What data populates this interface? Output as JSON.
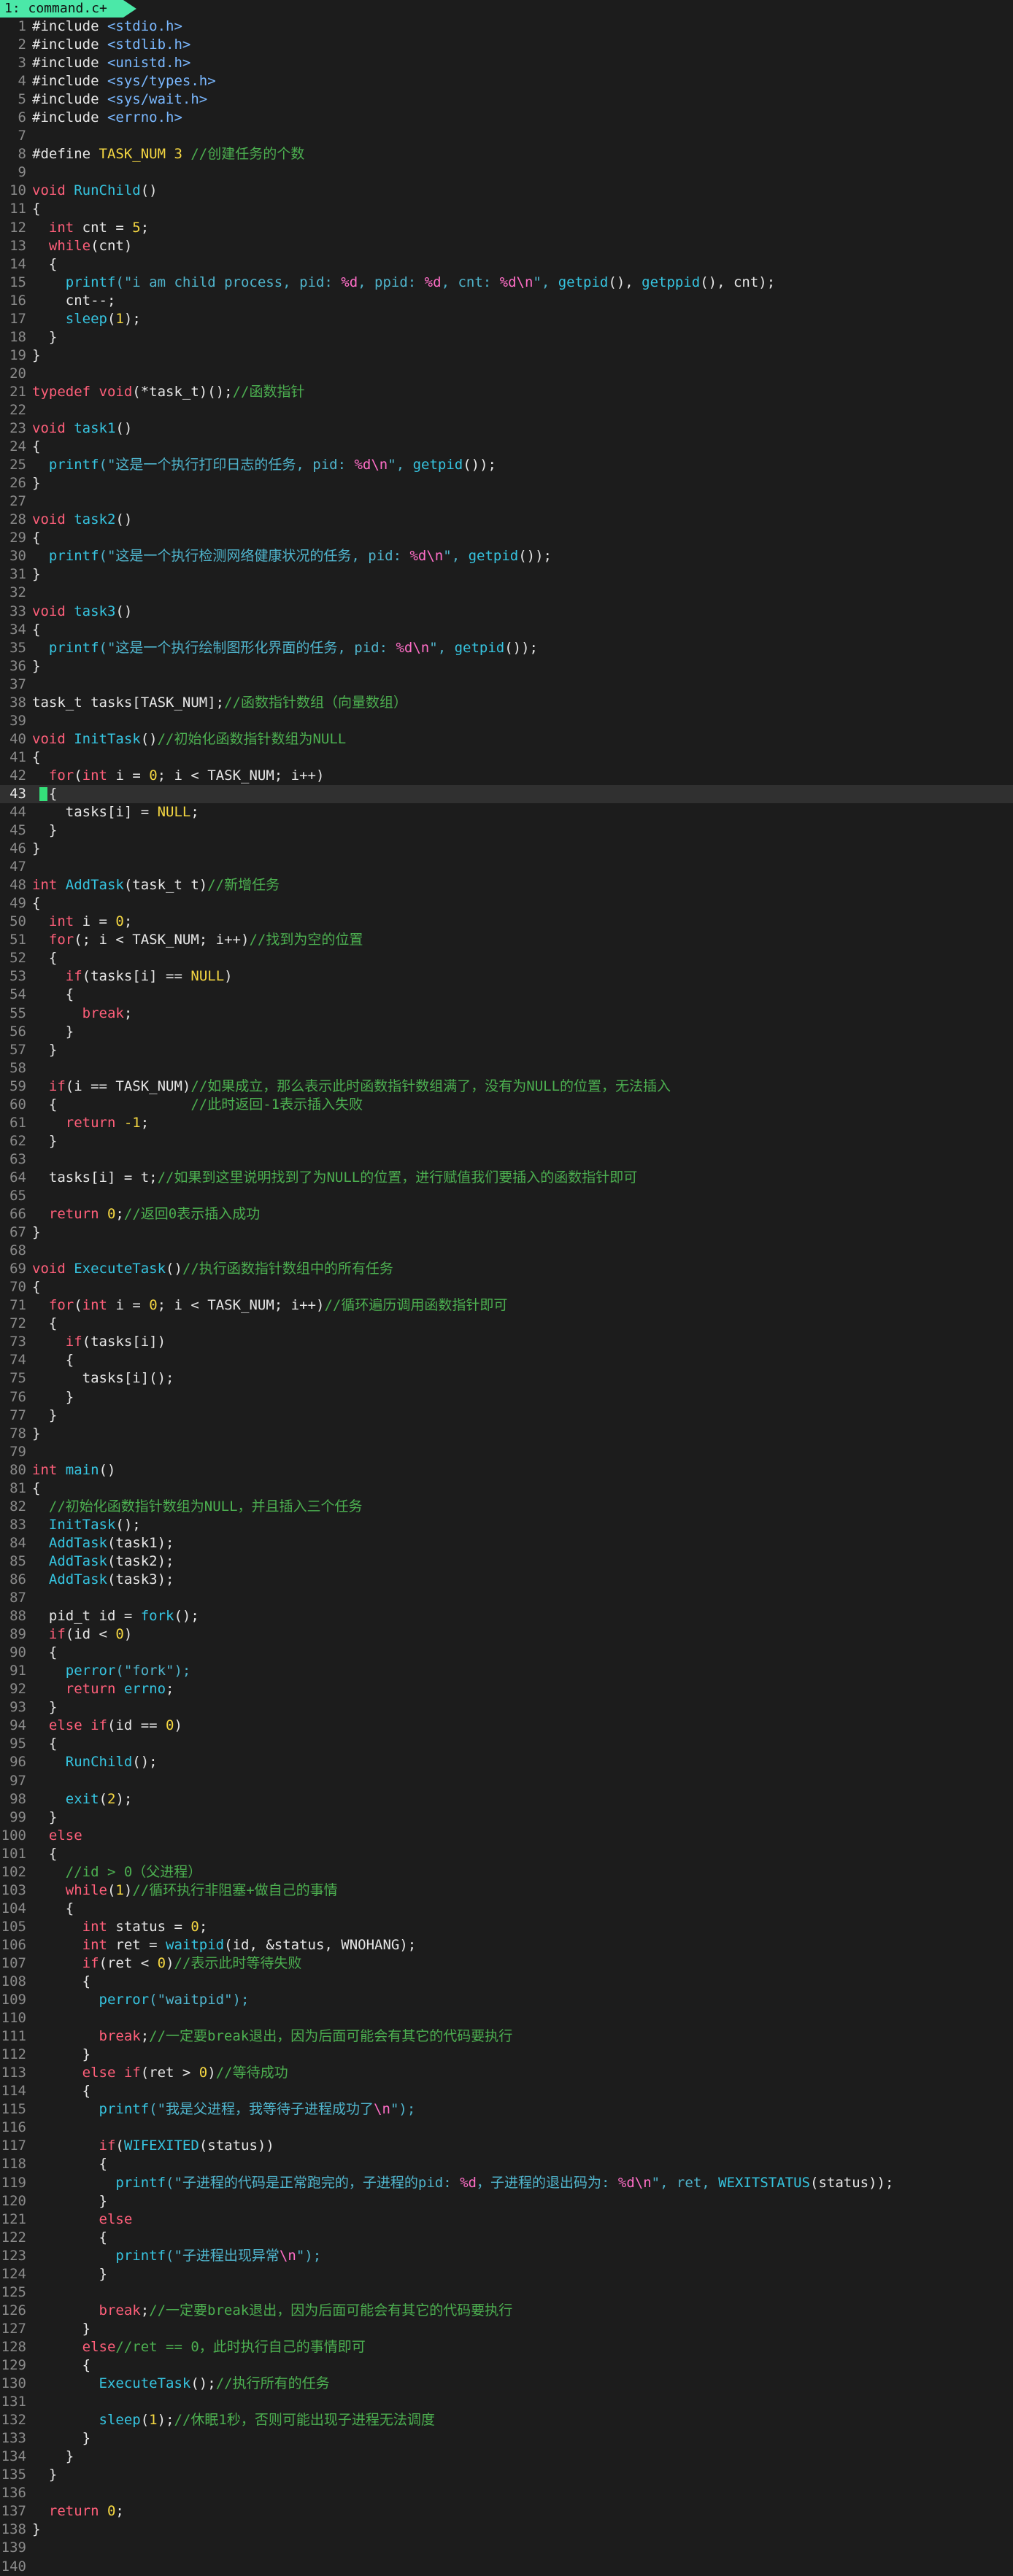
{
  "tab": {
    "label": "1: command.c+"
  },
  "cursor_line": 43,
  "colors": {
    "background": "#1c1c1c",
    "tab": "#4be8a8",
    "keyword": "#ff5f7a",
    "function": "#36c4e0",
    "string": "#4fb4cc",
    "number": "#f5d742",
    "comment": "#4caf50",
    "format": "#ff6ec7",
    "cursor": "#35e07a"
  },
  "lines": [
    [
      [
        "#include ",
        "tx"
      ],
      [
        "<stdio.h>",
        "hdr"
      ]
    ],
    [
      [
        "#include ",
        "tx"
      ],
      [
        "<stdlib.h>",
        "hdr"
      ]
    ],
    [
      [
        "#include ",
        "tx"
      ],
      [
        "<unistd.h>",
        "hdr"
      ]
    ],
    [
      [
        "#include ",
        "tx"
      ],
      [
        "<sys/types.h>",
        "hdr"
      ]
    ],
    [
      [
        "#include ",
        "tx"
      ],
      [
        "<sys/wait.h>",
        "hdr"
      ]
    ],
    [
      [
        "#include ",
        "tx"
      ],
      [
        "<errno.h>",
        "hdr"
      ]
    ],
    [],
    [
      [
        "#define ",
        "tx"
      ],
      [
        "TASK_NUM ",
        "num"
      ],
      [
        "3 ",
        "num"
      ],
      [
        "//创建任务的个数",
        "cm"
      ]
    ],
    [],
    [
      [
        "void ",
        "kw"
      ],
      [
        "RunChild",
        "fn"
      ],
      [
        "()",
        "tx"
      ]
    ],
    [
      [
        "{",
        "tx"
      ]
    ],
    [
      [
        "  ",
        "tx"
      ],
      [
        "int ",
        "kw"
      ],
      [
        "cnt = ",
        "tx"
      ],
      [
        "5",
        "num"
      ],
      [
        ";",
        "tx"
      ]
    ],
    [
      [
        "  ",
        "tx"
      ],
      [
        "while",
        "kw"
      ],
      [
        "(cnt)",
        "tx"
      ]
    ],
    [
      [
        "  {",
        "tx"
      ]
    ],
    [
      [
        "    ",
        "tx"
      ],
      [
        "printf",
        "fn"
      ],
      [
        "(\"i am child process, pid: ",
        "str"
      ],
      [
        "%d",
        "esc"
      ],
      [
        ", ppid: ",
        "str"
      ],
      [
        "%d",
        "esc"
      ],
      [
        ", cnt: ",
        "str"
      ],
      [
        "%d\\n",
        "esc"
      ],
      [
        "\", ",
        "str"
      ],
      [
        "getpid",
        "fn"
      ],
      [
        "(), ",
        "tx"
      ],
      [
        "getppid",
        "fn"
      ],
      [
        "(), cnt);",
        "tx"
      ]
    ],
    [
      [
        "    cnt--;",
        "tx"
      ]
    ],
    [
      [
        "    ",
        "tx"
      ],
      [
        "sleep",
        "fn"
      ],
      [
        "(",
        "tx"
      ],
      [
        "1",
        "num"
      ],
      [
        ");",
        "tx"
      ]
    ],
    [
      [
        "  }",
        "tx"
      ]
    ],
    [
      [
        "}",
        "tx"
      ]
    ],
    [],
    [
      [
        "typedef ",
        "kw"
      ],
      [
        "void",
        "kw"
      ],
      [
        "(*task_t)();",
        "tx"
      ],
      [
        "//函数指针",
        "cm"
      ]
    ],
    [],
    [
      [
        "void ",
        "kw"
      ],
      [
        "task1",
        "fn"
      ],
      [
        "()",
        "tx"
      ]
    ],
    [
      [
        "{",
        "tx"
      ]
    ],
    [
      [
        "  ",
        "tx"
      ],
      [
        "printf",
        "fn"
      ],
      [
        "(\"这是一个执行打印日志的任务, pid: ",
        "str"
      ],
      [
        "%d\\n",
        "esc"
      ],
      [
        "\", ",
        "str"
      ],
      [
        "getpid",
        "fn"
      ],
      [
        "());",
        "tx"
      ]
    ],
    [
      [
        "}",
        "tx"
      ]
    ],
    [],
    [
      [
        "void ",
        "kw"
      ],
      [
        "task2",
        "fn"
      ],
      [
        "()",
        "tx"
      ]
    ],
    [
      [
        "{",
        "tx"
      ]
    ],
    [
      [
        "  ",
        "tx"
      ],
      [
        "printf",
        "fn"
      ],
      [
        "(\"这是一个执行检测网络健康状况的任务, pid: ",
        "str"
      ],
      [
        "%d\\n",
        "esc"
      ],
      [
        "\", ",
        "str"
      ],
      [
        "getpid",
        "fn"
      ],
      [
        "());",
        "tx"
      ]
    ],
    [
      [
        "}",
        "tx"
      ]
    ],
    [],
    [
      [
        "void ",
        "kw"
      ],
      [
        "task3",
        "fn"
      ],
      [
        "()",
        "tx"
      ]
    ],
    [
      [
        "{",
        "tx"
      ]
    ],
    [
      [
        "  ",
        "tx"
      ],
      [
        "printf",
        "fn"
      ],
      [
        "(\"这是一个执行绘制图形化界面的任务, pid: ",
        "str"
      ],
      [
        "%d\\n",
        "esc"
      ],
      [
        "\", ",
        "str"
      ],
      [
        "getpid",
        "fn"
      ],
      [
        "());",
        "tx"
      ]
    ],
    [
      [
        "}",
        "tx"
      ]
    ],
    [],
    [
      [
        "task_t tasks[TASK_NUM];",
        "tx"
      ],
      [
        "//函数指针数组（向量数组）",
        "cm"
      ]
    ],
    [],
    [
      [
        "void ",
        "kw"
      ],
      [
        "InitTask",
        "fn"
      ],
      [
        "()",
        "tx"
      ],
      [
        "//初始化函数指针数组为NULL",
        "cm"
      ]
    ],
    [
      [
        "{",
        "tx"
      ]
    ],
    [
      [
        "  ",
        "tx"
      ],
      [
        "for",
        "kw"
      ],
      [
        "(",
        "tx"
      ],
      [
        "int ",
        "kw"
      ],
      [
        "i = ",
        "tx"
      ],
      [
        "0",
        "num"
      ],
      [
        "; i < TASK_NUM; i++)",
        "tx"
      ]
    ],
    [
      [
        "  {",
        "tx"
      ]
    ],
    [
      [
        "    tasks[i] = ",
        "tx"
      ],
      [
        "NULL",
        "num"
      ],
      [
        ";",
        "tx"
      ]
    ],
    [
      [
        "  }",
        "tx"
      ]
    ],
    [
      [
        "}",
        "tx"
      ]
    ],
    [],
    [
      [
        "int ",
        "kw"
      ],
      [
        "AddTask",
        "fn"
      ],
      [
        "(task_t t)",
        "tx"
      ],
      [
        "//新增任务",
        "cm"
      ]
    ],
    [
      [
        "{",
        "tx"
      ]
    ],
    [
      [
        "  ",
        "tx"
      ],
      [
        "int ",
        "kw"
      ],
      [
        "i = ",
        "tx"
      ],
      [
        "0",
        "num"
      ],
      [
        ";",
        "tx"
      ]
    ],
    [
      [
        "  ",
        "tx"
      ],
      [
        "for",
        "kw"
      ],
      [
        "(; i < TASK_NUM; i++)",
        "tx"
      ],
      [
        "//找到为空的位置",
        "cm"
      ]
    ],
    [
      [
        "  {",
        "tx"
      ]
    ],
    [
      [
        "    ",
        "tx"
      ],
      [
        "if",
        "kw"
      ],
      [
        "(tasks[i] == ",
        "tx"
      ],
      [
        "NULL",
        "num"
      ],
      [
        ")",
        "tx"
      ]
    ],
    [
      [
        "    {",
        "tx"
      ]
    ],
    [
      [
        "      ",
        "tx"
      ],
      [
        "break",
        "kw"
      ],
      [
        ";",
        "tx"
      ]
    ],
    [
      [
        "    }",
        "tx"
      ]
    ],
    [
      [
        "  }",
        "tx"
      ]
    ],
    [],
    [
      [
        "  ",
        "tx"
      ],
      [
        "if",
        "kw"
      ],
      [
        "(i == TASK_NUM)",
        "tx"
      ],
      [
        "//如果成立，那么表示此时函数指针数组满了，没有为NULL的位置，无法插入",
        "cm"
      ]
    ],
    [
      [
        "  {                ",
        "tx"
      ],
      [
        "//此时返回-1表示插入失败",
        "cm"
      ]
    ],
    [
      [
        "    ",
        "tx"
      ],
      [
        "return ",
        "kw"
      ],
      [
        "-1",
        "num"
      ],
      [
        ";",
        "tx"
      ]
    ],
    [
      [
        "  }",
        "tx"
      ]
    ],
    [],
    [
      [
        "  tasks[i] = t;",
        "tx"
      ],
      [
        "//如果到这里说明找到了为NULL的位置，进行赋值我们要插入的函数指针即可",
        "cm"
      ]
    ],
    [],
    [
      [
        "  ",
        "tx"
      ],
      [
        "return ",
        "kw"
      ],
      [
        "0",
        "num"
      ],
      [
        ";",
        "tx"
      ],
      [
        "//返回0表示插入成功",
        "cm"
      ]
    ],
    [
      [
        "}",
        "tx"
      ]
    ],
    [],
    [
      [
        "void ",
        "kw"
      ],
      [
        "ExecuteTask",
        "fn"
      ],
      [
        "()",
        "tx"
      ],
      [
        "//执行函数指针数组中的所有任务",
        "cm"
      ]
    ],
    [
      [
        "{",
        "tx"
      ]
    ],
    [
      [
        "  ",
        "tx"
      ],
      [
        "for",
        "kw"
      ],
      [
        "(",
        "tx"
      ],
      [
        "int ",
        "kw"
      ],
      [
        "i = ",
        "tx"
      ],
      [
        "0",
        "num"
      ],
      [
        "; i < TASK_NUM; i++)",
        "tx"
      ],
      [
        "//循环遍历调用函数指针即可",
        "cm"
      ]
    ],
    [
      [
        "  {",
        "tx"
      ]
    ],
    [
      [
        "    ",
        "tx"
      ],
      [
        "if",
        "kw"
      ],
      [
        "(tasks[i])",
        "tx"
      ]
    ],
    [
      [
        "    {",
        "tx"
      ]
    ],
    [
      [
        "      tasks[i]();",
        "tx"
      ]
    ],
    [
      [
        "    }",
        "tx"
      ]
    ],
    [
      [
        "  }",
        "tx"
      ]
    ],
    [
      [
        "}",
        "tx"
      ]
    ],
    [],
    [
      [
        "int ",
        "kw"
      ],
      [
        "main",
        "fn"
      ],
      [
        "()",
        "tx"
      ]
    ],
    [
      [
        "{",
        "tx"
      ]
    ],
    [
      [
        "  ",
        "tx"
      ],
      [
        "//初始化函数指针数组为NULL，并且插入三个任务",
        "cm"
      ]
    ],
    [
      [
        "  ",
        "tx"
      ],
      [
        "InitTask",
        "fn"
      ],
      [
        "();",
        "tx"
      ]
    ],
    [
      [
        "  ",
        "tx"
      ],
      [
        "AddTask",
        "fn"
      ],
      [
        "(task1);",
        "tx"
      ]
    ],
    [
      [
        "  ",
        "tx"
      ],
      [
        "AddTask",
        "fn"
      ],
      [
        "(task2);",
        "tx"
      ]
    ],
    [
      [
        "  ",
        "tx"
      ],
      [
        "AddTask",
        "fn"
      ],
      [
        "(task3);",
        "tx"
      ]
    ],
    [],
    [
      [
        "  pid_t id = ",
        "tx"
      ],
      [
        "fork",
        "fn"
      ],
      [
        "();",
        "tx"
      ]
    ],
    [
      [
        "  ",
        "tx"
      ],
      [
        "if",
        "kw"
      ],
      [
        "(id < ",
        "tx"
      ],
      [
        "0",
        "num"
      ],
      [
        ")",
        "tx"
      ]
    ],
    [
      [
        "  {",
        "tx"
      ]
    ],
    [
      [
        "    ",
        "tx"
      ],
      [
        "perror",
        "fn"
      ],
      [
        "(\"fork\");",
        "str"
      ]
    ],
    [
      [
        "    ",
        "tx"
      ],
      [
        "return ",
        "kw"
      ],
      [
        "errno",
        "fn"
      ],
      [
        ";",
        "tx"
      ]
    ],
    [
      [
        "  }",
        "tx"
      ]
    ],
    [
      [
        "  ",
        "tx"
      ],
      [
        "else if",
        "kw"
      ],
      [
        "(id == ",
        "tx"
      ],
      [
        "0",
        "num"
      ],
      [
        ")",
        "tx"
      ]
    ],
    [
      [
        "  {",
        "tx"
      ]
    ],
    [
      [
        "    ",
        "tx"
      ],
      [
        "RunChild",
        "fn"
      ],
      [
        "();",
        "tx"
      ]
    ],
    [],
    [
      [
        "    ",
        "tx"
      ],
      [
        "exit",
        "fn"
      ],
      [
        "(",
        "tx"
      ],
      [
        "2",
        "num"
      ],
      [
        ");",
        "tx"
      ]
    ],
    [
      [
        "  }",
        "tx"
      ]
    ],
    [
      [
        "  ",
        "tx"
      ],
      [
        "else",
        "kw"
      ]
    ],
    [
      [
        "  {",
        "tx"
      ]
    ],
    [
      [
        "    ",
        "tx"
      ],
      [
        "//id > 0（父进程）",
        "cm"
      ]
    ],
    [
      [
        "    ",
        "tx"
      ],
      [
        "while",
        "kw"
      ],
      [
        "(",
        "tx"
      ],
      [
        "1",
        "num"
      ],
      [
        ")",
        "tx"
      ],
      [
        "//循环执行非阻塞+做自己的事情",
        "cm"
      ]
    ],
    [
      [
        "    {",
        "tx"
      ]
    ],
    [
      [
        "      ",
        "tx"
      ],
      [
        "int ",
        "kw"
      ],
      [
        "status = ",
        "tx"
      ],
      [
        "0",
        "num"
      ],
      [
        ";",
        "tx"
      ]
    ],
    [
      [
        "      ",
        "tx"
      ],
      [
        "int ",
        "kw"
      ],
      [
        "ret = ",
        "tx"
      ],
      [
        "waitpid",
        "fn"
      ],
      [
        "(id, &status, WNOHANG);",
        "tx"
      ]
    ],
    [
      [
        "      ",
        "tx"
      ],
      [
        "if",
        "kw"
      ],
      [
        "(ret < ",
        "tx"
      ],
      [
        "0",
        "num"
      ],
      [
        ")",
        "tx"
      ],
      [
        "//表示此时等待失败",
        "cm"
      ]
    ],
    [
      [
        "      {",
        "tx"
      ]
    ],
    [
      [
        "        ",
        "tx"
      ],
      [
        "perror",
        "fn"
      ],
      [
        "(\"waitpid\");",
        "str"
      ]
    ],
    [],
    [
      [
        "        ",
        "tx"
      ],
      [
        "break",
        "kw"
      ],
      [
        ";",
        "tx"
      ],
      [
        "//一定要break退出，因为后面可能会有其它的代码要执行",
        "cm"
      ]
    ],
    [
      [
        "      }",
        "tx"
      ]
    ],
    [
      [
        "      ",
        "tx"
      ],
      [
        "else if",
        "kw"
      ],
      [
        "(ret > ",
        "tx"
      ],
      [
        "0",
        "num"
      ],
      [
        ")",
        "tx"
      ],
      [
        "//等待成功",
        "cm"
      ]
    ],
    [
      [
        "      {",
        "tx"
      ]
    ],
    [
      [
        "        ",
        "tx"
      ],
      [
        "printf",
        "fn"
      ],
      [
        "(\"我是父进程，我等待子进程成功了",
        "str"
      ],
      [
        "\\n",
        "esc"
      ],
      [
        "\");",
        "str"
      ]
    ],
    [],
    [
      [
        "        ",
        "tx"
      ],
      [
        "if",
        "kw"
      ],
      [
        "(",
        "tx"
      ],
      [
        "WIFEXITED",
        "fn"
      ],
      [
        "(status))",
        "tx"
      ]
    ],
    [
      [
        "        {",
        "tx"
      ]
    ],
    [
      [
        "          ",
        "tx"
      ],
      [
        "printf",
        "fn"
      ],
      [
        "(\"子进程的代码是正常跑完的，子进程的pid: ",
        "str"
      ],
      [
        "%d",
        "esc"
      ],
      [
        "，子进程的退出码为: ",
        "str"
      ],
      [
        "%d\\n",
        "esc"
      ],
      [
        "\", ret, ",
        "str"
      ],
      [
        "WEXITSTATUS",
        "fn"
      ],
      [
        "(status));",
        "tx"
      ]
    ],
    [
      [
        "        }",
        "tx"
      ]
    ],
    [
      [
        "        ",
        "tx"
      ],
      [
        "else",
        "kw"
      ]
    ],
    [
      [
        "        {",
        "tx"
      ]
    ],
    [
      [
        "          ",
        "tx"
      ],
      [
        "printf",
        "fn"
      ],
      [
        "(\"子进程出现异常",
        "str"
      ],
      [
        "\\n",
        "esc"
      ],
      [
        "\");",
        "str"
      ]
    ],
    [
      [
        "        }",
        "tx"
      ]
    ],
    [],
    [
      [
        "        ",
        "tx"
      ],
      [
        "break",
        "kw"
      ],
      [
        ";",
        "tx"
      ],
      [
        "//一定要break退出，因为后面可能会有其它的代码要执行",
        "cm"
      ]
    ],
    [
      [
        "      }",
        "tx"
      ]
    ],
    [
      [
        "      ",
        "tx"
      ],
      [
        "else",
        "kw"
      ],
      [
        "//ret == 0，此时执行自己的事情即可",
        "cm"
      ]
    ],
    [
      [
        "      {",
        "tx"
      ]
    ],
    [
      [
        "        ",
        "tx"
      ],
      [
        "ExecuteTask",
        "fn"
      ],
      [
        "();",
        "tx"
      ],
      [
        "//执行所有的任务",
        "cm"
      ]
    ],
    [],
    [
      [
        "        ",
        "tx"
      ],
      [
        "sleep",
        "fn"
      ],
      [
        "(",
        "tx"
      ],
      [
        "1",
        "num"
      ],
      [
        ");",
        "tx"
      ],
      [
        "//休眠1秒，否则可能出现子进程无法调度",
        "cm"
      ]
    ],
    [
      [
        "      }",
        "tx"
      ]
    ],
    [
      [
        "    }",
        "tx"
      ]
    ],
    [
      [
        "  }",
        "tx"
      ]
    ],
    [],
    [
      [
        "  ",
        "tx"
      ],
      [
        "return ",
        "kw"
      ],
      [
        "0",
        "num"
      ],
      [
        ";",
        "tx"
      ]
    ],
    [
      [
        "}",
        "tx"
      ]
    ],
    [],
    []
  ]
}
